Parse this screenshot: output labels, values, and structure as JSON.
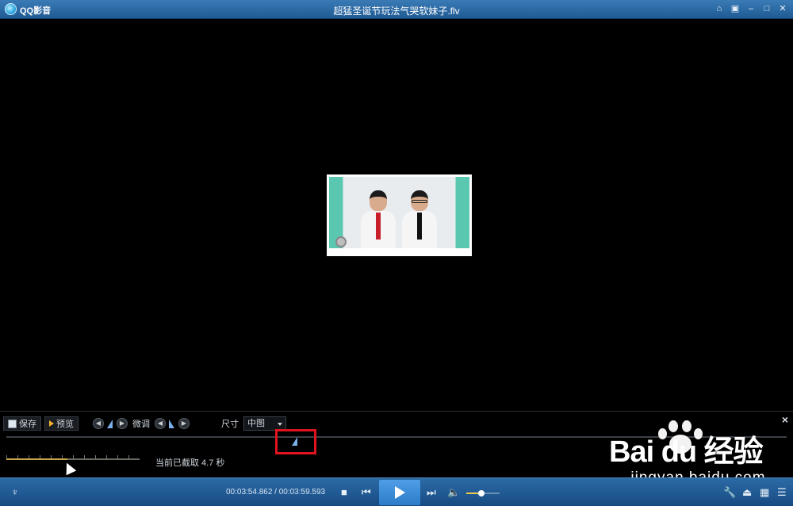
{
  "window": {
    "app_name": "QQ影音",
    "title": "超猛圣诞节玩法气哭软妹子.flv",
    "buttons": [
      "⌂",
      "▣",
      "–",
      "□",
      "✕"
    ]
  },
  "capture_panel": {
    "save_label": "保存",
    "preview_label": "预览",
    "fine_tune_label": "微调",
    "size_label": "尺寸",
    "size_value": "中图",
    "close_label": "×",
    "captured_text": "当前已截取 4.7 秒",
    "mini_progress": 0.46
  },
  "controls": {
    "time": "00:03:54.862 / 00:03:59.593",
    "volume": 0.45
  },
  "watermark": {
    "main": "Bai du 经验",
    "sub": "jingyan.baidu.com"
  },
  "colors": {
    "titlebar": "#2a69a5",
    "highlight_box": "#e0141e",
    "accent": "#4f9ee6"
  }
}
